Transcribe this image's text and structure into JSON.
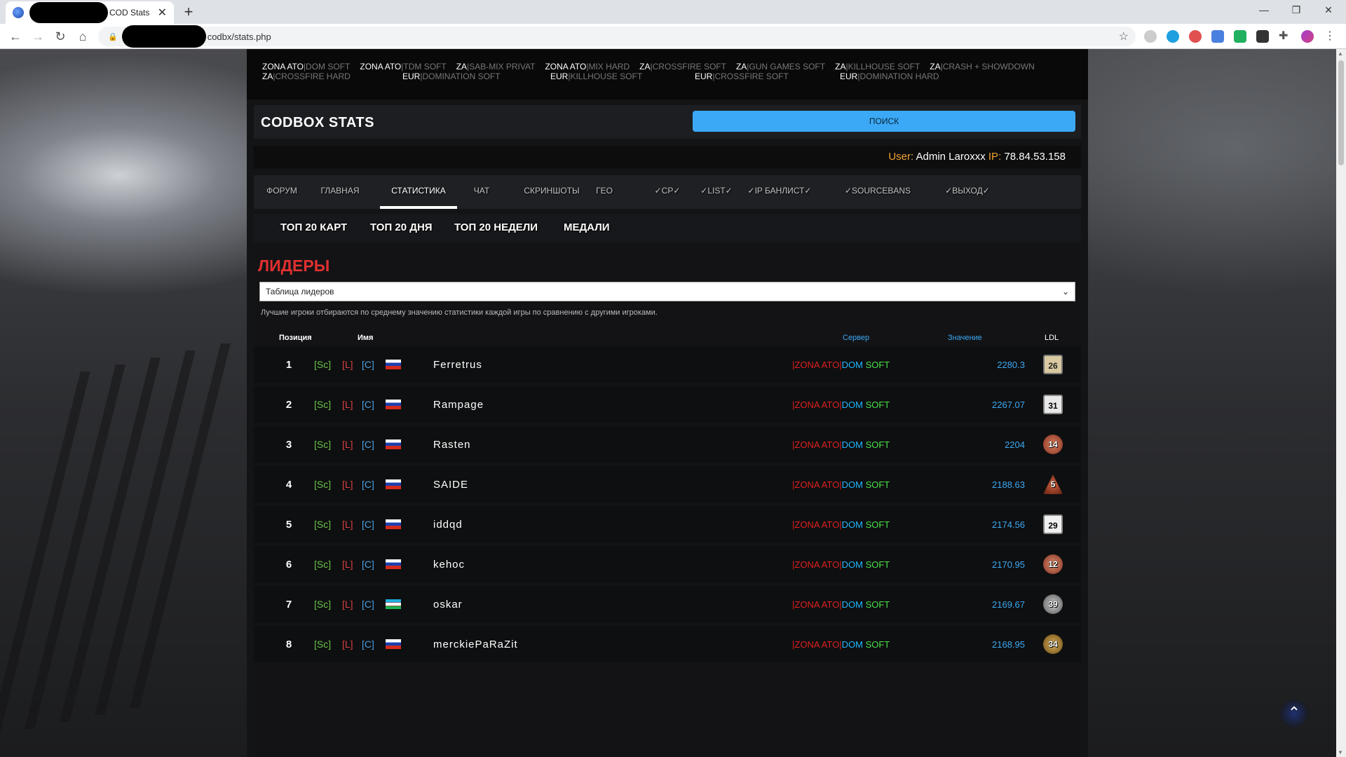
{
  "browser": {
    "tab_title": "COD Stats",
    "url_path": "codbx/stats.php"
  },
  "top_servers": {
    "row1": [
      {
        "a": "ZONA ATO",
        "b": "DOM SOFT"
      },
      {
        "a": "ZONA ATO",
        "b": "TDM SOFT"
      },
      {
        "a": "ZA",
        "b": "SAB-MIX PRIVAT"
      },
      {
        "a": "ZONA ATO",
        "b": "MIX HARD"
      },
      {
        "a": "ZA",
        "b": "CROSSFIRE SOFT"
      },
      {
        "a": "ZA",
        "b": "GUN GAMES SOFT"
      },
      {
        "a": "ZA",
        "b": "KILLHOUSE SOFT"
      },
      {
        "a": "ZA",
        "b": "CRASH + SHOWDOWN"
      }
    ],
    "row2": [
      {
        "a": "ZA",
        "b": "CROSSFIRE HARD"
      },
      {
        "a": "EUR",
        "b": "DOMINATION SOFT"
      },
      {
        "a": "EUR",
        "b": "KILLHOUSE SOFT"
      },
      {
        "a": "EUR",
        "b": "CROSSFIRE SOFT"
      },
      {
        "a": "EUR",
        "b": "DOMINATION HARD"
      }
    ]
  },
  "header": {
    "logo": "CODBOX STATS",
    "search_label": "ПОИСК"
  },
  "userbar": {
    "user_key": "User:",
    "user_value": "Admin Laroxxx",
    "ip_key": "IP:",
    "ip_value": "78.84.53.158"
  },
  "menu": [
    "ФОРУМ",
    "ГЛАВНАЯ",
    "СТАТИСТИКА",
    "ЧАТ",
    "СКРИНШОТЫ",
    "ГЕО",
    "✓CP✓",
    "✓LIST✓",
    "✓IP БАНЛИСТ✓",
    "✓SOURCEBANS БАНЛИСТ✓",
    "✓ВЫХОД✓"
  ],
  "submenu": [
    "ТОП 20 КАРТ",
    "ТОП 20 ДНЯ",
    "ТОП 20 НЕДЕЛИ",
    "МЕДАЛИ"
  ],
  "leaders": {
    "title": "ЛИДЕРЫ",
    "select_value": "Таблица лидеров",
    "description": "Лучшие игроки отбираются по среднему значению статистики каждой игры по сравнению с другими игроками.",
    "columns": {
      "position": "Позиция",
      "name": "Имя",
      "server": "Сервер",
      "value": "Значение",
      "ldl": "LDL"
    },
    "tags": {
      "sc": "[Sc]",
      "l": "[L]",
      "c": "[C]"
    },
    "rows": [
      {
        "pos": "1",
        "name": "Ferretrus",
        "flag": "ru",
        "server_a": "ZONA ATO",
        "server_b": "DOM",
        "server_c": "SOFT",
        "value": "2280.3",
        "ldl": "26"
      },
      {
        "pos": "2",
        "name": "Rampage",
        "flag": "ru",
        "server_a": "ZONA ATO",
        "server_b": "DOM",
        "server_c": "SOFT",
        "value": "2267.07",
        "ldl": "31"
      },
      {
        "pos": "3",
        "name": "Rasten",
        "flag": "ru",
        "server_a": "ZONA ATO",
        "server_b": "DOM",
        "server_c": "SOFT",
        "value": "2204",
        "ldl": "14"
      },
      {
        "pos": "4",
        "name": "SAIDE",
        "flag": "ru",
        "server_a": "ZONA ATO",
        "server_b": "DOM",
        "server_c": "SOFT",
        "value": "2188.63",
        "ldl": "5"
      },
      {
        "pos": "5",
        "name": "iddqd",
        "flag": "ru",
        "server_a": "ZONA ATO",
        "server_b": "DOM",
        "server_c": "SOFT",
        "value": "2174.56",
        "ldl": "29"
      },
      {
        "pos": "6",
        "name": "kehoc",
        "flag": "ru",
        "server_a": "ZONA ATO",
        "server_b": "DOM",
        "server_c": "SOFT",
        "value": "2170.95",
        "ldl": "12"
      },
      {
        "pos": "7",
        "name": "oskar",
        "flag": "uz",
        "server_a": "ZONA ATO",
        "server_b": "DOM",
        "server_c": "SOFT",
        "value": "2169.67",
        "ldl": "39"
      },
      {
        "pos": "8",
        "name": "merckiePaRaZit",
        "flag": "ru",
        "server_a": "ZONA ATO",
        "server_b": "DOM",
        "server_c": "SOFT",
        "value": "2168.95",
        "ldl": "34"
      }
    ]
  },
  "colors": {
    "accent_blue": "#3ba9f5",
    "title_red": "#e23030",
    "user_orange": "#f0a030"
  }
}
